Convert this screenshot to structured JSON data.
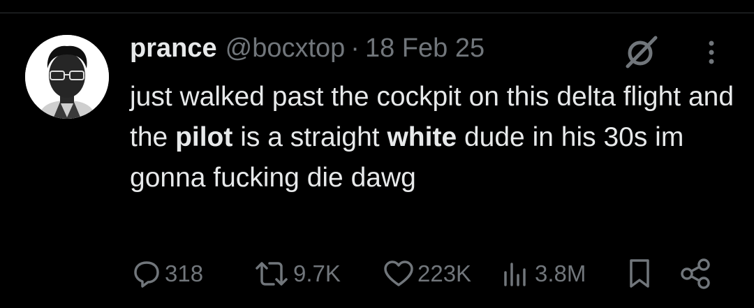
{
  "tweet": {
    "author_name": "prance",
    "author_handle": "@bocxtop",
    "separator": "·",
    "date": "18 Feb 25",
    "text_segments": [
      {
        "text": "just walked past the cockpit on this delta flight and the ",
        "bold": false
      },
      {
        "text": "pilot",
        "bold": true
      },
      {
        "text": " is a straight ",
        "bold": false
      },
      {
        "text": "white",
        "bold": true
      },
      {
        "text": " dude in his 30s im gonna fucking die dawg",
        "bold": false
      }
    ]
  },
  "icons": {
    "avatar": "avatar-photo",
    "grok": "grok-icon",
    "more": "more-dots-icon",
    "reply": "reply-icon",
    "retweet": "retweet-icon",
    "like": "heart-icon",
    "views": "views-chart-icon",
    "bookmark": "bookmark-icon",
    "share": "share-icon"
  },
  "stats": {
    "replies": "318",
    "retweets": "9.7K",
    "likes": "223K",
    "views": "3.8M"
  },
  "colors": {
    "background": "#000000",
    "text": "#e7e9ea",
    "muted": "#71767b"
  }
}
